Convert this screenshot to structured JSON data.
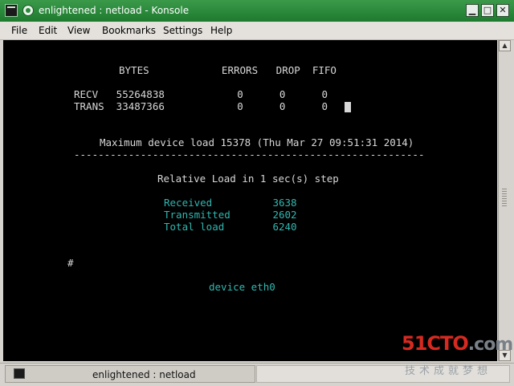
{
  "window": {
    "title": "enlightened : netload - Konsole",
    "buttons": {
      "minimize": "▁",
      "maximize": "□",
      "close": "✕"
    }
  },
  "menu": [
    "File",
    "Edit",
    "View",
    "Bookmarks",
    "Settings",
    "Help"
  ],
  "terminal": {
    "header": "BYTES            ERRORS   DROP  FIFO",
    "rows": [
      "RECV   55264838            0      0      0",
      "TRANS  33487366            0      0      0"
    ],
    "max_load": "Maximum device load 15378 (Thu Mar 27 09:51:31 2014)",
    "separator": "----------------------------------------------------------",
    "relative_load": "Relative Load in 1 sec(s) step",
    "stats": [
      "Received          3638",
      "Transmitted       2602",
      "Total load        6240"
    ],
    "prompt": "#",
    "device": "device eth0"
  },
  "taskbar": {
    "task_label": "enlightened : netload"
  },
  "watermark": {
    "logo_main": "51CTO",
    "logo_suffix": ".com",
    "tagline": "技术成就梦想"
  },
  "colors": {
    "titlebar": "#2a8a3a",
    "terminal_bg": "#000000",
    "terminal_fg": "#d8d8d8",
    "cyan": "#2fb7b0",
    "watermark_red": "#d62a20"
  }
}
